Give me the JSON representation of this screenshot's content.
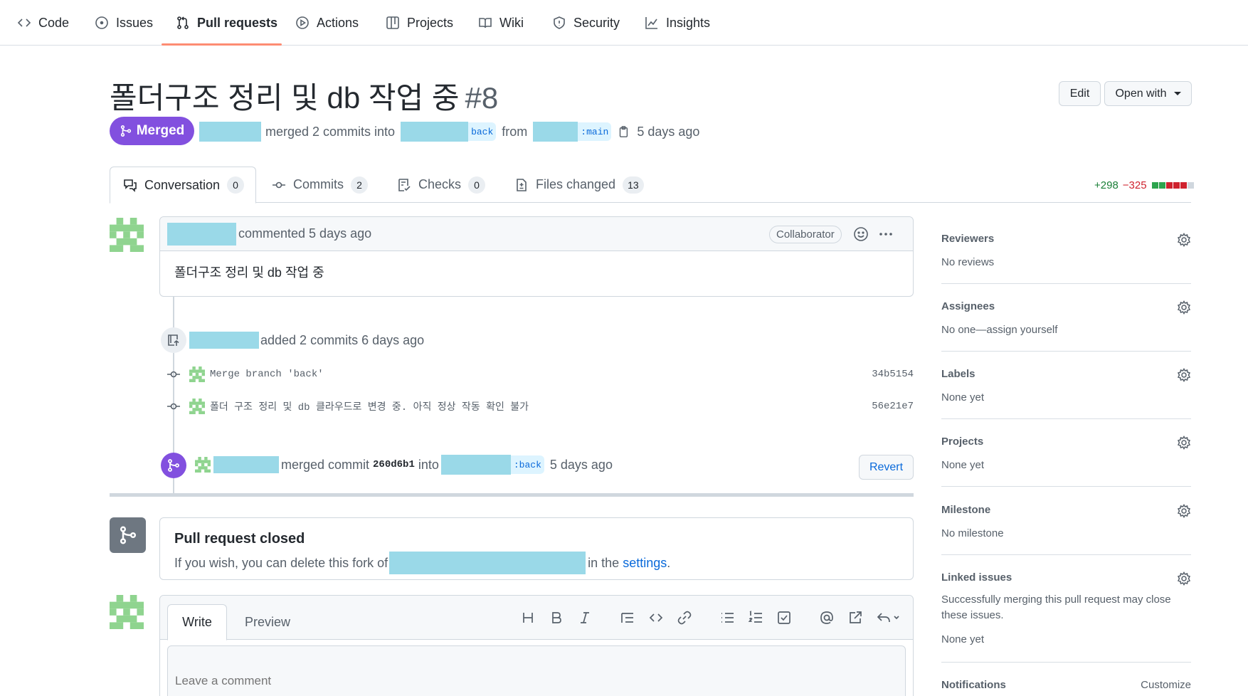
{
  "repo_nav": {
    "tabs": [
      {
        "label": "Code",
        "icon": "code-icon"
      },
      {
        "label": "Issues",
        "icon": "issue-icon"
      },
      {
        "label": "Pull requests",
        "icon": "pull-request-icon"
      },
      {
        "label": "Actions",
        "icon": "play-icon"
      },
      {
        "label": "Projects",
        "icon": "table-icon"
      },
      {
        "label": "Wiki",
        "icon": "book-icon"
      },
      {
        "label": "Security",
        "icon": "shield-icon"
      },
      {
        "label": "Insights",
        "icon": "graph-icon"
      }
    ],
    "active": "Pull requests"
  },
  "pr": {
    "title": "폴더구조 정리 및 db 작업 중",
    "number": "#8",
    "state": "Merged",
    "merge_text": "merged 2 commits into",
    "base_branch": "back",
    "from_text": "from",
    "head_branch": ":main",
    "time": "5 days ago"
  },
  "header_buttons": {
    "edit": "Edit",
    "open_with": "Open with"
  },
  "pr_tabs": [
    {
      "label": "Conversation",
      "count": "0"
    },
    {
      "label": "Commits",
      "count": "2"
    },
    {
      "label": "Checks",
      "count": "0"
    },
    {
      "label": "Files changed",
      "count": "13"
    }
  ],
  "diffstat": {
    "additions": "+298",
    "deletions": "−325",
    "colors": [
      "#2da44e",
      "#2da44e",
      "#cf222e",
      "#cf222e",
      "#cf222e",
      "#d0d7de"
    ]
  },
  "comment": {
    "action": "commented 5 days ago",
    "role": "Collaborator",
    "body": "폴더구조 정리 및 db 작업 중"
  },
  "commits_event": {
    "text": "added 2 commits 6 days ago",
    "commits": [
      {
        "message": "Merge branch 'back'",
        "sha": "34b5154"
      },
      {
        "message": "폴더 구조 정리 및 db 클라우드로 변경 중. 아직 정상 작동 확인 불가",
        "sha": "56e21e7"
      }
    ]
  },
  "merge_event": {
    "text_before": "merged commit",
    "sha": "260d6b1",
    "text_into": "into",
    "branch": ":back",
    "time": "5 days ago",
    "revert": "Revert"
  },
  "closed": {
    "title": "Pull request closed",
    "text_before": "If you wish, you can delete this fork of",
    "text_after": "in the",
    "link": "settings",
    "period": "."
  },
  "editor": {
    "tabs": [
      "Write",
      "Preview"
    ],
    "placeholder": "Leave a comment",
    "toolbar": [
      "heading-icon",
      "bold-icon",
      "italic-icon",
      "quote-icon",
      "code-icon",
      "link-icon",
      "bulleted-list-icon",
      "numbered-list-icon",
      "task-list-icon",
      "mention-icon",
      "reference-icon",
      "reply-icon"
    ]
  },
  "sidebar": [
    {
      "title": "Reviewers",
      "value": "No reviews"
    },
    {
      "title": "Assignees",
      "value": "No one—assign yourself"
    },
    {
      "title": "Labels",
      "value": "None yet"
    },
    {
      "title": "Projects",
      "value": "None yet"
    },
    {
      "title": "Milestone",
      "value": "No milestone"
    },
    {
      "title": "Linked issues",
      "value": "Successfully merging this pull request may close these issues.",
      "value2": "None yet"
    }
  ],
  "notifications": {
    "title": "Notifications",
    "action": "Customize"
  },
  "colors": {
    "merged": "#8250df",
    "accent": "#0969da",
    "underline": "#fd8c73",
    "redaction": "#9ad9e8"
  }
}
